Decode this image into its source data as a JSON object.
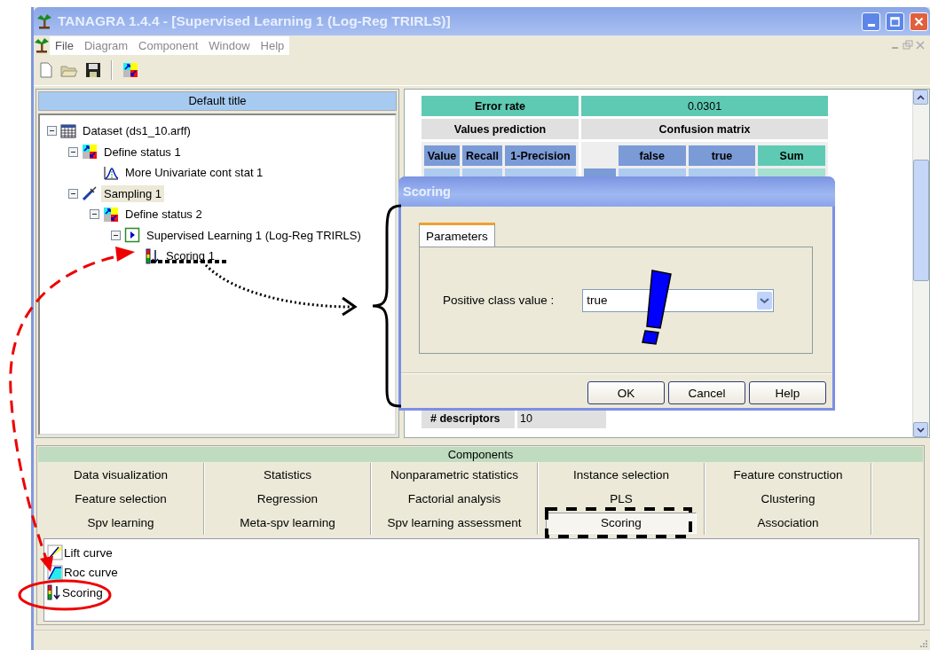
{
  "window": {
    "title": "TANAGRA 1.4.4 - [Supervised Learning 1 (Log-Reg TRIRLS)]"
  },
  "menu": [
    "File",
    "Diagram",
    "Component",
    "Window",
    "Help"
  ],
  "tree": {
    "title": "Default title",
    "nodes": [
      {
        "label": "Dataset (ds1_10.arff)",
        "kind": "dataset",
        "expanded": true,
        "selected": false,
        "children": [
          {
            "label": "Define status 1",
            "kind": "status",
            "expanded": true,
            "selected": false,
            "children": [
              {
                "label": "More Univariate cont stat 1",
                "kind": "chart",
                "selected": false
              }
            ]
          },
          {
            "label": "Sampling 1",
            "kind": "sampling",
            "expanded": true,
            "selected": true,
            "children": [
              {
                "label": "Define status 2",
                "kind": "status",
                "expanded": true,
                "selected": false,
                "children": [
                  {
                    "label": "Supervised Learning 1 (Log-Reg TRIRLS)",
                    "kind": "learner",
                    "expanded": true,
                    "selected": false,
                    "children": [
                      {
                        "label": "Scoring 1",
                        "kind": "scoring",
                        "selected": false
                      }
                    ]
                  }
                ]
              }
            ]
          }
        ]
      }
    ]
  },
  "results": {
    "error_rate_label": "Error rate",
    "error_rate": "0.0301",
    "values_prediction": "Values prediction",
    "confusion_matrix": "Confusion matrix",
    "prediction_columns": [
      "Value",
      "Recall",
      "1-Precision"
    ],
    "matrix_columns": [
      "false",
      "true",
      "Sum"
    ],
    "descriptors_label": "# descriptors",
    "descriptors": "10"
  },
  "components": {
    "title": "Components",
    "tabs": [
      [
        {
          "label": "Data visualization",
          "selected": false
        },
        {
          "label": "Statistics",
          "selected": false
        },
        {
          "label": "Nonparametric statistics",
          "selected": false
        },
        {
          "label": "Instance selection",
          "selected": false
        },
        {
          "label": "Feature construction",
          "selected": false
        }
      ],
      [
        {
          "label": "Feature selection",
          "selected": false
        },
        {
          "label": "Regression",
          "selected": false
        },
        {
          "label": "Factorial analysis",
          "selected": false
        },
        {
          "label": "PLS",
          "selected": false
        },
        {
          "label": "Clustering",
          "selected": false
        }
      ],
      [
        {
          "label": "Spv learning",
          "selected": false
        },
        {
          "label": "Meta-spv learning",
          "selected": false
        },
        {
          "label": "Spv learning assessment",
          "selected": false
        },
        {
          "label": "Scoring",
          "selected": true
        },
        {
          "label": "Association",
          "selected": false
        }
      ]
    ],
    "items": [
      {
        "label": "Lift curve",
        "kind": "lift"
      },
      {
        "label": "Roc curve",
        "kind": "roc"
      },
      {
        "label": "Scoring",
        "kind": "scoring"
      }
    ]
  },
  "dialog": {
    "title": "Scoring",
    "tabs": [
      {
        "label": "Parameters",
        "selected": true
      }
    ],
    "field_label": "Positive class value :",
    "field_value": "true",
    "buttons": [
      "OK",
      "Cancel",
      "Help"
    ]
  }
}
